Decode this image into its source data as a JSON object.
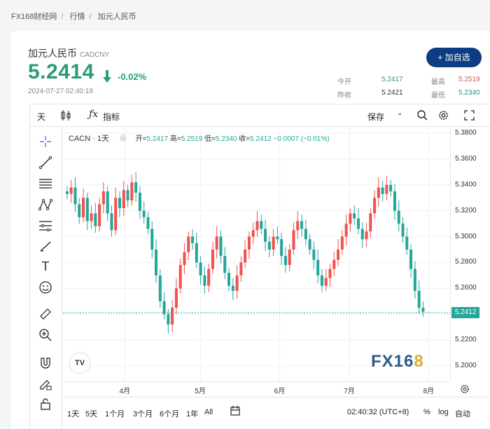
{
  "breadcrumb": [
    "FX168财经网",
    "行情",
    "加元人民币"
  ],
  "quote": {
    "name": "加元人民币",
    "code": "CADCNY",
    "price": "5.2414",
    "change": "-0.02%",
    "timestamp": "2024-07-27 02:40:19",
    "add_watch": "+ 加自选",
    "stats": [
      {
        "label": "今开",
        "value": "5.2417",
        "color": "#2a9d74"
      },
      {
        "label": "最高",
        "value": "5.2519",
        "color": "#d9534f"
      },
      {
        "label": "昨收",
        "value": "5.2421",
        "color": "#333333"
      },
      {
        "label": "最低",
        "value": "5.2340",
        "color": "#2a9d74"
      }
    ]
  },
  "toolbar": {
    "interval": "天",
    "indicators": "指标",
    "save": "保存"
  },
  "legend": {
    "symbol": "CACN · 1天",
    "open_label": "开=",
    "open": "5.2417",
    "high_label": "高=",
    "high": "5.2519",
    "low_label": "低=",
    "low": "5.2340",
    "close_label": "收=",
    "close": "5.2412",
    "change": "−0.0007 (−0.01%)"
  },
  "chart_data": {
    "type": "candlestick",
    "y_ticks": [
      "5.3800",
      "5.3600",
      "5.3400",
      "5.3200",
      "5.3000",
      "5.2800",
      "5.2600",
      "5.2400",
      "5.2200",
      "5.2000"
    ],
    "ylim": [
      5.2,
      5.38
    ],
    "x_ticks": [
      "4月",
      "5月",
      "6月",
      "7月",
      "8月"
    ],
    "last_price": "5.2412",
    "up_color": "#ef5350",
    "down_color": "#26a69a",
    "closes": [
      5.333,
      5.338,
      5.325,
      5.315,
      5.33,
      5.312,
      5.318,
      5.308,
      5.325,
      5.335,
      5.318,
      5.305,
      5.33,
      5.322,
      5.336,
      5.328,
      5.342,
      5.334,
      5.32,
      5.315,
      5.306,
      5.29,
      5.27,
      5.25,
      5.24,
      5.232,
      5.245,
      5.26,
      5.278,
      5.288,
      5.3,
      5.295,
      5.28,
      5.27,
      5.262,
      5.275,
      5.29,
      5.3,
      5.285,
      5.272,
      5.262,
      5.258,
      5.27,
      5.28,
      5.29,
      5.3,
      5.305,
      5.312,
      5.306,
      5.296,
      5.29,
      5.3,
      5.298,
      5.285,
      5.278,
      5.29,
      5.305,
      5.312,
      5.306,
      5.298,
      5.29,
      5.282,
      5.27,
      5.262,
      5.268,
      5.275,
      5.282,
      5.29,
      5.3,
      5.31,
      5.318,
      5.314,
      5.306,
      5.298,
      5.304,
      5.318,
      5.33,
      5.338,
      5.333,
      5.34,
      5.335,
      5.32,
      5.31,
      5.3,
      5.29,
      5.275,
      5.258,
      5.245,
      5.242
    ],
    "bottom_ranges": [
      "1天",
      "5天",
      "1个月",
      "3个月",
      "6个月",
      "1年",
      "All"
    ],
    "clock": "02:40:32 (UTC+8)",
    "percent": "%",
    "log": "log",
    "auto": "自动"
  },
  "watermark": {
    "main": "FX16",
    "accent": "8"
  },
  "tv_logo": "TV"
}
